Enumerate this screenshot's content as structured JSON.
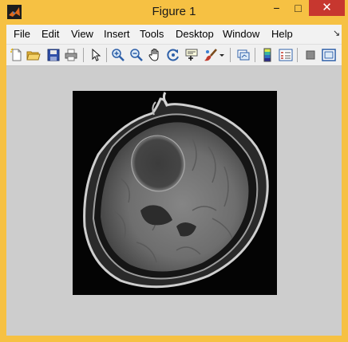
{
  "window": {
    "title": "Figure 1",
    "controls": {
      "minimize": "−",
      "maximize": "□",
      "close": "✕"
    }
  },
  "menubar": {
    "items": [
      "File",
      "Edit",
      "View",
      "Insert",
      "Tools",
      "Desktop",
      "Window",
      "Help"
    ],
    "expand_glyph": "↘"
  },
  "toolbar": {
    "icons": [
      "new-figure-icon",
      "open-file-icon",
      "save-figure-icon",
      "print-figure-icon",
      "edit-plot-icon",
      "zoom-in-icon",
      "zoom-out-icon",
      "pan-icon",
      "rotate-3d-icon",
      "data-cursor-icon",
      "brush-icon",
      "brush-dropdown-icon",
      "link-plot-icon",
      "insert-colorbar-icon",
      "insert-legend-icon",
      "hide-plot-tools-icon",
      "show-plot-tools-icon"
    ]
  },
  "figure": {
    "image_content": "axial brain MRI slice, grayscale",
    "background_color": "#cdcdcd"
  }
}
